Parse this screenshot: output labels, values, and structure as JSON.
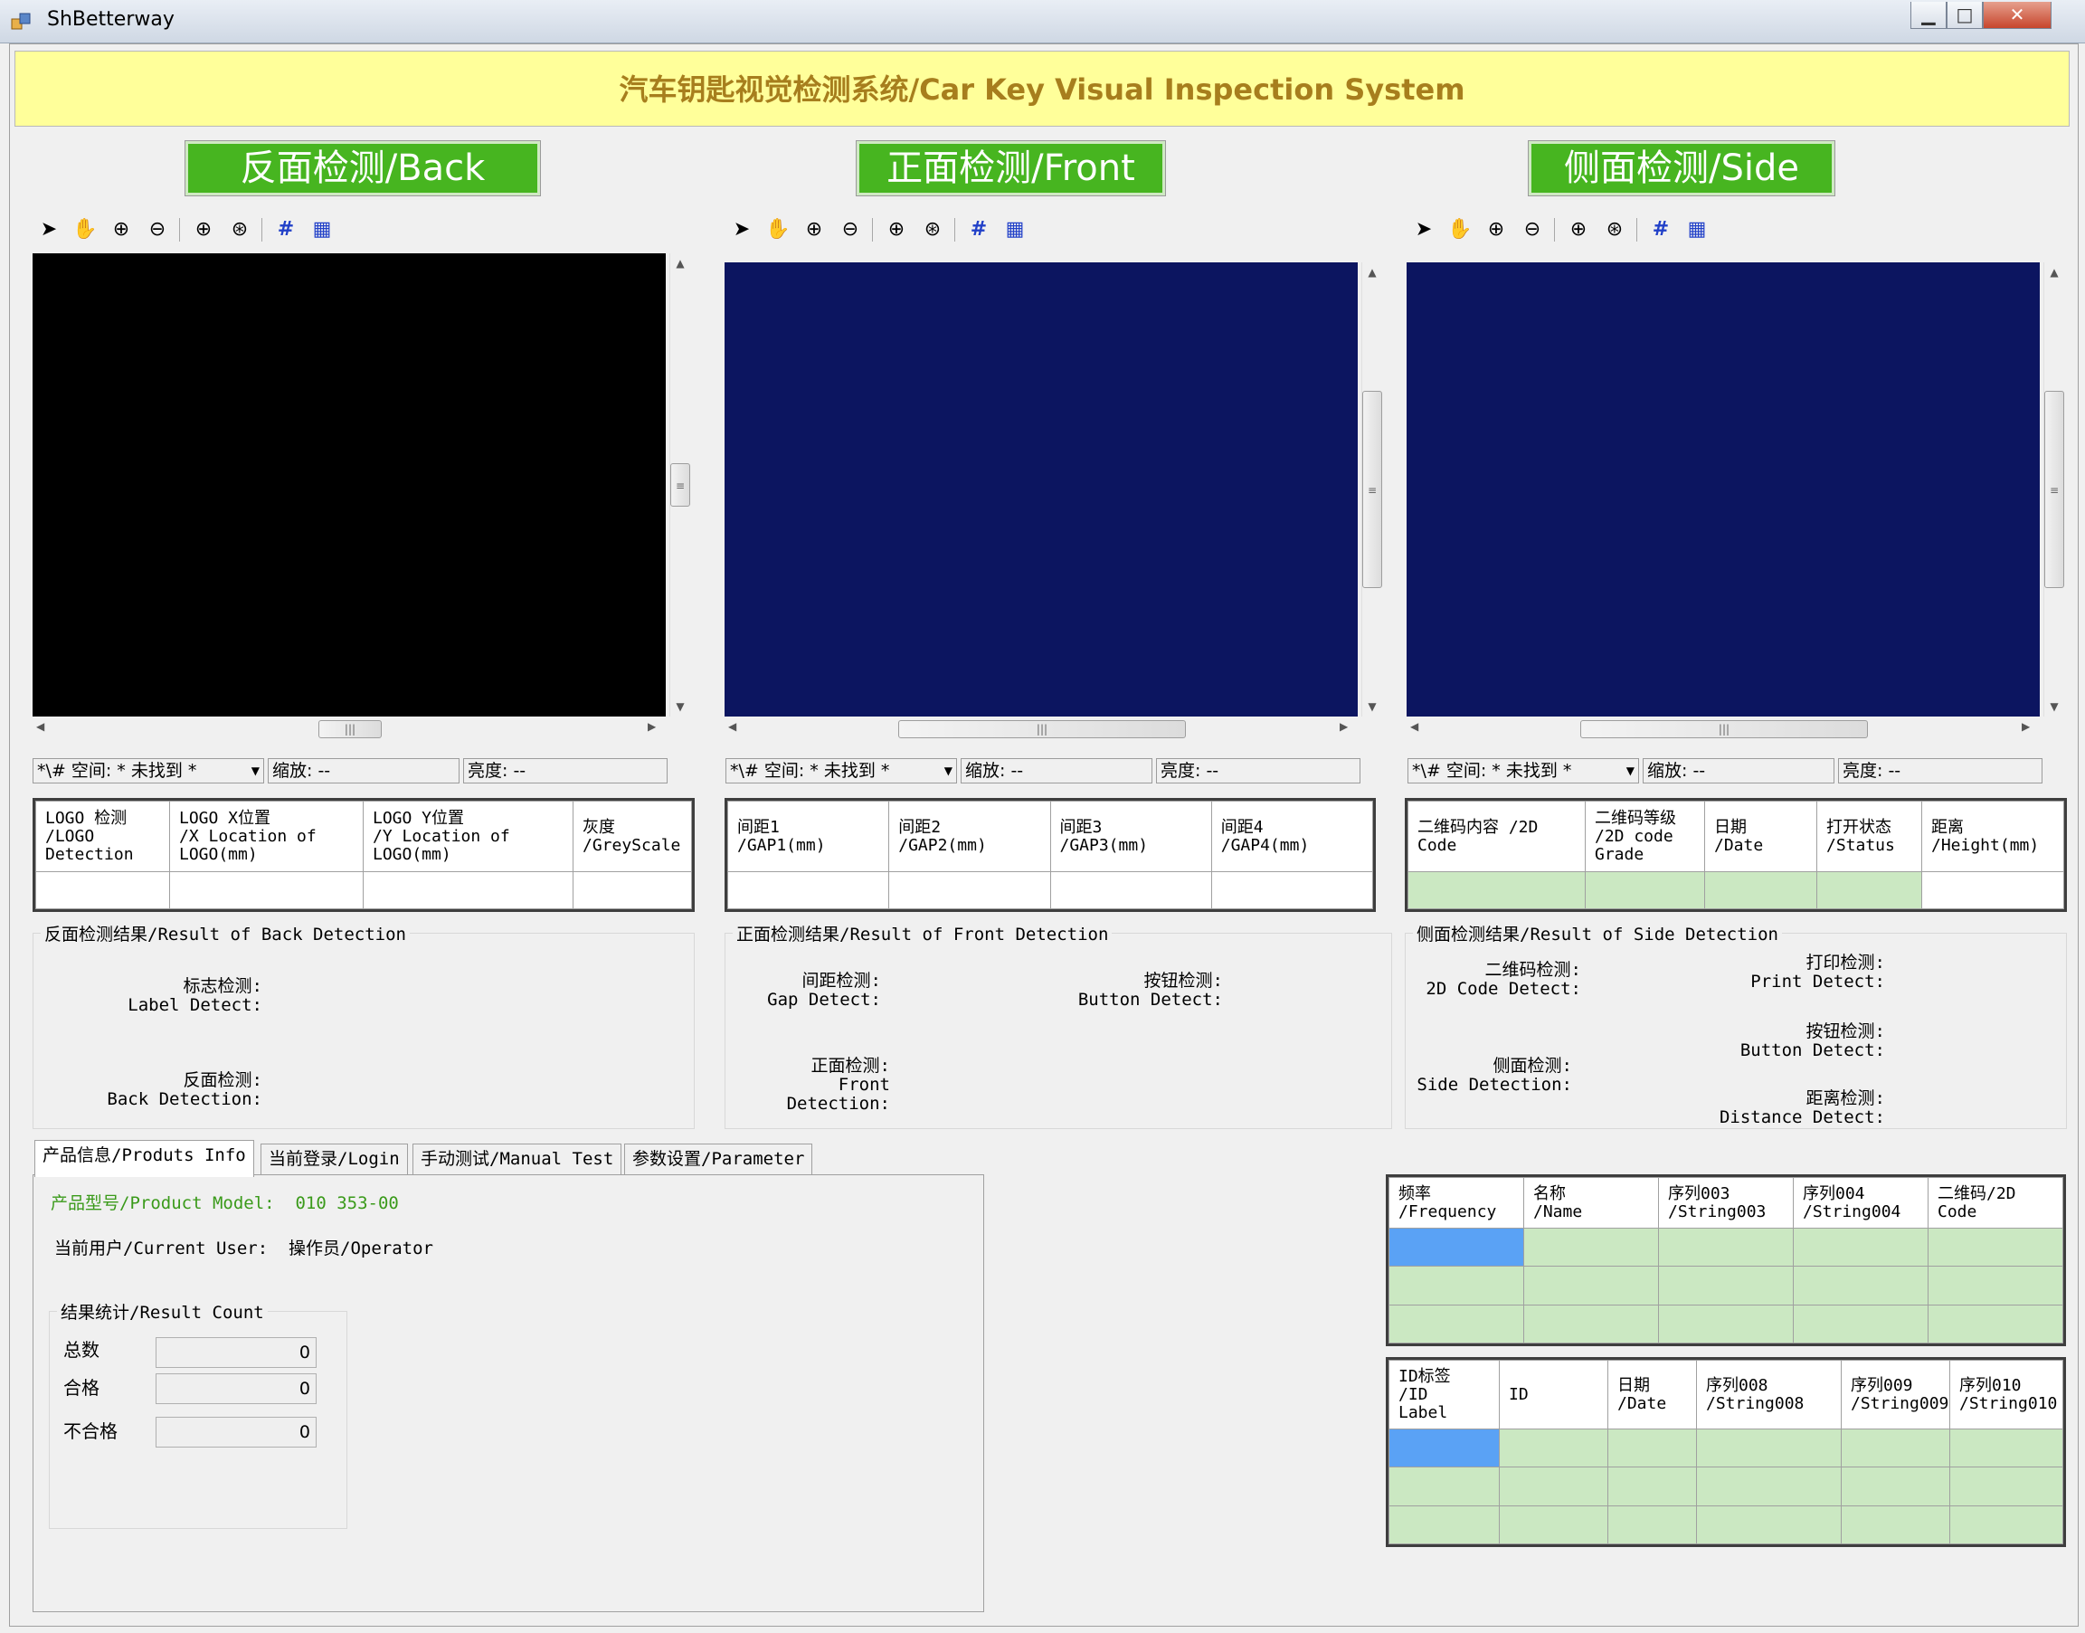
{
  "window": {
    "title": "ShBetterway",
    "buttons": {
      "minimize": "▁",
      "maximize": "□",
      "close": "✕"
    }
  },
  "banner": "汽车钥匙视觉检测系统/Car Key Visual Inspection System",
  "panels": {
    "back": {
      "title": "反面检测/Back",
      "status_space": "*\\# 空间: * 未找到 *",
      "status_zoom": "缩放: --",
      "status_bright": "亮度: --"
    },
    "front": {
      "title": "正面检测/Front",
      "status_space": "*\\# 空间: * 未找到 *",
      "status_zoom": "缩放: --",
      "status_bright": "亮度: --"
    },
    "side": {
      "title": "侧面检测/Side",
      "status_space": "*\\# 空间: * 未找到 *",
      "status_zoom": "缩放: --",
      "status_bright": "亮度: --"
    }
  },
  "tables": {
    "back": {
      "headers": [
        "LOGO 检测\n/LOGO\nDetection",
        "LOGO X位置\n/X Location of\nLOGO(mm)",
        "LOGO Y位置\n/Y Location of\nLOGO(mm)",
        "灰度\n/GreyScale"
      ]
    },
    "front": {
      "headers": [
        "间距1\n/GAP1(mm)",
        "间距2\n/GAP2(mm)",
        "间距3\n/GAP3(mm)",
        "间距4\n/GAP4(mm)"
      ]
    },
    "side": {
      "headers": [
        "二维码内容  /2D\nCode",
        "二维码等级\n/2D code\nGrade",
        "日期\n/Date",
        "打开状态\n/Status",
        "距离\n/Height(mm)"
      ]
    },
    "freq": {
      "headers": [
        "频率\n/Frequency",
        "名称\n/Name",
        "序列003\n/String003",
        "序列004\n/String004",
        "二维码/2D\nCode"
      ]
    },
    "idlabel": {
      "headers": [
        "ID标签\n/ID\nLabel",
        "ID",
        "日期\n/Date",
        "序列008\n/String008",
        "序列009\n/String009",
        "序列010\n/String010"
      ]
    }
  },
  "results": {
    "back": {
      "legend": "反面检测结果/Result of Back Detection",
      "label_detect": "标志检测:\nLabel Detect:",
      "back_detection": "反面检测:\nBack Detection:"
    },
    "front": {
      "legend": "正面检测结果/Result of Front Detection",
      "gap_detect": "间距检测:\nGap Detect:",
      "button_detect": "按钮检测:\nButton Detect:",
      "front_detection": "正面检测:\nFront Detection:"
    },
    "side": {
      "legend": "侧面检测结果/Result of Side Detection",
      "code_detect": "二维码检测:\n2D Code Detect:",
      "print_detect": "打印检测:\nPrint Detect:",
      "button_detect": "按钮检测:\nButton Detect:",
      "side_detection": "侧面检测:\nSide Detection:",
      "distance_detect": "距离检测:\nDistance Detect:"
    }
  },
  "tabs": [
    "产品信息/Produts Info",
    "当前登录/Login",
    "手动测试/Manual Test",
    "参数设置/Parameter"
  ],
  "info": {
    "product_model_label": "产品型号/Product Model:",
    "product_model_value": "010 353-00",
    "current_user_label": "当前用户/Current User:",
    "current_user_value": "操作员/Operator",
    "count_legend": "结果统计/Result Count",
    "total_label": "总数",
    "total_value": "0",
    "pass_label": "合格",
    "pass_value": "0",
    "fail_label": "不合格",
    "fail_value": "0"
  },
  "colors": {
    "banner_bg": "#ffff9a",
    "banner_text": "#a77e1d",
    "button_green": "#47b520",
    "back_view": "#000000",
    "front_view": "#0c1560",
    "side_view": "#0c1560",
    "cell_green": "#cbe8c2",
    "cell_selected": "#5aa2f5"
  },
  "toolbar_icons": [
    "pointer-icon",
    "pan-hand-icon",
    "zoom-in-icon",
    "zoom-out-icon",
    "zoom-fit-icon",
    "zoom-actual-icon",
    "grid-icon",
    "fine-grid-icon"
  ]
}
